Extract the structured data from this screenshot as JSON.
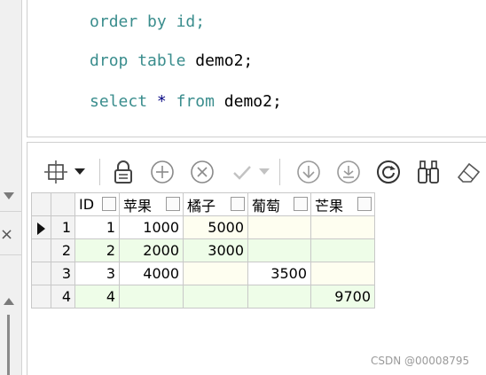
{
  "editor": {
    "line_partial": {
      "kw1": "order by",
      "rest": " id;"
    },
    "line_drop": {
      "kw1": "drop table",
      "rest": " demo2;"
    },
    "line_select": {
      "kw1": "select",
      "star": "*",
      "kw2": "from",
      "rest": " demo2;"
    }
  },
  "toolbar": {
    "icons": [
      "grid-layout-icon",
      "dropdown-arrow-icon",
      "lock-icon",
      "add-row-icon",
      "delete-row-icon",
      "apply-check-icon",
      "apply-dropdown-icon",
      "download-icon",
      "download-circle-icon",
      "refresh-icon",
      "binoculars-icon",
      "eraser-icon"
    ]
  },
  "grid": {
    "columns": [
      "ID",
      "苹果",
      "橘子",
      "葡萄",
      "芒果"
    ],
    "rows": [
      {
        "num": "1",
        "id": "1",
        "apple": "1000",
        "orange": "5000",
        "grape": "",
        "mango": ""
      },
      {
        "num": "2",
        "id": "2",
        "apple": "2000",
        "orange": "3000",
        "grape": "",
        "mango": ""
      },
      {
        "num": "3",
        "id": "3",
        "apple": "4000",
        "orange": "",
        "grape": "3500",
        "mango": ""
      },
      {
        "num": "4",
        "id": "4",
        "apple": "",
        "orange": "",
        "grape": "",
        "mango": "9700"
      }
    ]
  },
  "watermark": "CSDN @00008795",
  "colors": {
    "odd_row": "#fefef0",
    "even_row": "#eefde8",
    "keyword": "#3a8d8d"
  }
}
